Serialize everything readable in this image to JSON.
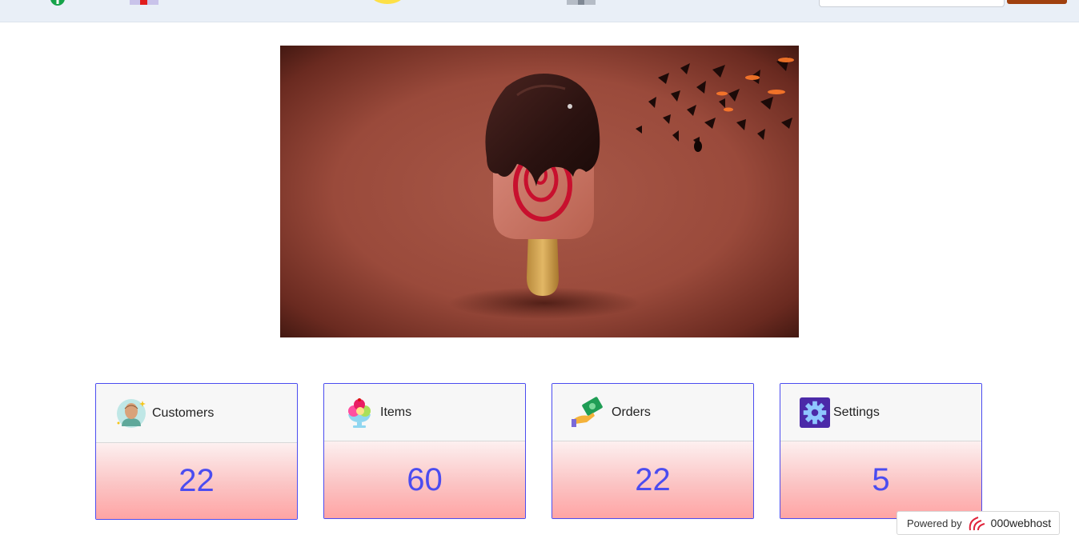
{
  "topbar": {
    "search_placeholder": "",
    "button_label": ""
  },
  "hero": {
    "alt": "Popsicle dipped in chocolate"
  },
  "cards": [
    {
      "title": "Customers",
      "value": "22",
      "icon": "customer-avatar-icon"
    },
    {
      "title": "Items",
      "value": "60",
      "icon": "ice-cream-icon"
    },
    {
      "title": "Orders",
      "value": "22",
      "icon": "money-hand-icon"
    },
    {
      "title": "Settings",
      "value": "5",
      "icon": "gear-icon"
    }
  ],
  "powered": {
    "prefix": "Powered by",
    "brand": "000webhost"
  },
  "colors": {
    "accent": "#4b4cf0",
    "topbar_bg": "#e9eff7",
    "topbar_button": "#a0410f",
    "card_gradient_end": "#ffa4a4"
  }
}
